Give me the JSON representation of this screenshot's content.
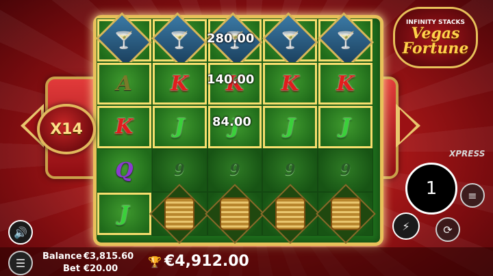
{
  "game": {
    "logo_top": "INFINITY STACKS",
    "logo_main_1": "Vegas",
    "logo_main_2": "Fortune",
    "multiplier": "X14",
    "xpress": "XPRESS",
    "spin_count": "1"
  },
  "reels": {
    "rows": [
      [
        "martini",
        "martini",
        "martini",
        "martini",
        "martini"
      ],
      [
        "A",
        "K",
        "K",
        "K",
        "K"
      ],
      [
        "K",
        "J",
        "J",
        "J",
        "J"
      ],
      [
        "Q",
        "9",
        "9",
        "9",
        "9"
      ],
      [
        "J",
        "coins",
        "coins",
        "coins",
        "coins"
      ]
    ],
    "win_labels": [
      "280.00",
      "140.00",
      "84.00"
    ]
  },
  "footer": {
    "balance_label": "Balance",
    "balance_value": "€3,815.60",
    "bet_label": "Bet",
    "bet_value": "€20.00",
    "total_win": "€4,912.00"
  },
  "icons": {
    "sound": "speaker-icon",
    "menu": "hamburger-icon",
    "trophy": "trophy-icon",
    "bolt": "lightning-icon",
    "stack": "coin-stack-icon",
    "autoplay": "autoplay-icon"
  }
}
